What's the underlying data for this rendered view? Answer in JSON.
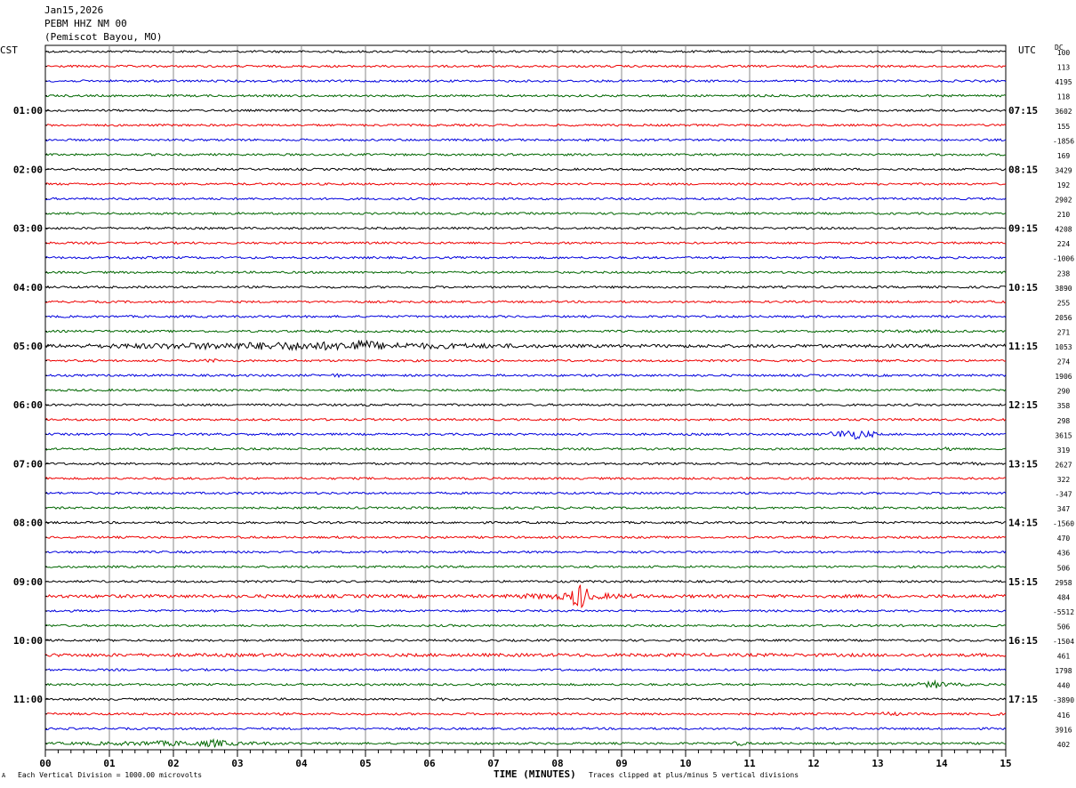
{
  "header": {
    "date": "Jan15,2026",
    "station": "PEBM HHZ NM 00",
    "location": "(Pemiscot Bayou, MO)"
  },
  "left_tz": "CST",
  "right_tz": "UTC",
  "dc_label": "DC",
  "footer": {
    "scale_note": "Each Vertical Division = 1000.00 microvolts",
    "clip_note": "Traces clipped at plus/minus 5 vertical divisions",
    "corner_mark": "A"
  },
  "colors": {
    "trace_cycle": [
      "#000000",
      "#ee0000",
      "#0000dd",
      "#006600"
    ],
    "grid": "#888888"
  },
  "chart_data": {
    "type": "line",
    "title": "",
    "xlabel": "TIME (MINUTES)",
    "ylabel": "",
    "xlim": [
      0,
      15
    ],
    "x_ticks": [
      "00",
      "01",
      "02",
      "03",
      "04",
      "05",
      "06",
      "07",
      "08",
      "09",
      "10",
      "11",
      "12",
      "13",
      "14",
      "15"
    ],
    "rows": 48,
    "minutes_per_row": 15,
    "left_hour_labels": [
      {
        "row": 4,
        "text": "01:00"
      },
      {
        "row": 8,
        "text": "02:00"
      },
      {
        "row": 12,
        "text": "03:00"
      },
      {
        "row": 16,
        "text": "04:00"
      },
      {
        "row": 20,
        "text": "05:00"
      },
      {
        "row": 24,
        "text": "06:00"
      },
      {
        "row": 28,
        "text": "07:00"
      },
      {
        "row": 32,
        "text": "08:00"
      },
      {
        "row": 36,
        "text": "09:00"
      },
      {
        "row": 40,
        "text": "10:00"
      },
      {
        "row": 44,
        "text": "11:00"
      }
    ],
    "right_hour_labels": [
      {
        "row": 4,
        "text": "07:15"
      },
      {
        "row": 8,
        "text": "08:15"
      },
      {
        "row": 12,
        "text": "09:15"
      },
      {
        "row": 16,
        "text": "10:15"
      },
      {
        "row": 20,
        "text": "11:15"
      },
      {
        "row": 24,
        "text": "12:15"
      },
      {
        "row": 28,
        "text": "13:15"
      },
      {
        "row": 32,
        "text": "14:15"
      },
      {
        "row": 36,
        "text": "15:15"
      },
      {
        "row": 40,
        "text": "16:15"
      },
      {
        "row": 44,
        "text": "17:15"
      }
    ],
    "dc_offsets": [
      "100",
      "113",
      "4195",
      "118",
      "3602",
      "155",
      "-1856",
      "169",
      "3429",
      "192",
      "2902",
      "210",
      "4208",
      "224",
      "-1006",
      "238",
      "3890",
      "255",
      "2056",
      "271",
      "1053",
      "274",
      "1906",
      "290",
      "358",
      "298",
      "3615",
      "319",
      "2627",
      "322",
      "-347",
      "347",
      "-1560",
      "470",
      "436",
      "506",
      "2958",
      "484",
      "-5512",
      "506",
      "-1504",
      "461",
      "1798",
      "440",
      "-3890",
      "416",
      "3916",
      "402"
    ],
    "base_amplitude": [
      2,
      2,
      2,
      2,
      2,
      2,
      2,
      2,
      2,
      2,
      2,
      2,
      2,
      2,
      2,
      2,
      2,
      2,
      2,
      2,
      3,
      2,
      2,
      2,
      2,
      2,
      2,
      2,
      2,
      2,
      2,
      2,
      2,
      2,
      2,
      2,
      2,
      3,
      2,
      2,
      2,
      3,
      2,
      2,
      2,
      2,
      2,
      2
    ],
    "events": [
      {
        "row": 14,
        "start": 0.4,
        "end": 2.2,
        "amp": 3
      },
      {
        "row": 19,
        "start": 12.2,
        "end": 15.0,
        "amp": 3
      },
      {
        "row": 20,
        "start": 0.2,
        "end": 7.8,
        "amp": 8
      },
      {
        "row": 20,
        "start": 4.4,
        "end": 5.4,
        "amp": 12
      },
      {
        "row": 21,
        "start": 2.4,
        "end": 2.8,
        "amp": 4
      },
      {
        "row": 22,
        "start": 4.4,
        "end": 4.7,
        "amp": 4
      },
      {
        "row": 23,
        "start": 8.2,
        "end": 8.5,
        "amp": 4
      },
      {
        "row": 24,
        "start": 4.9,
        "end": 5.2,
        "amp": 3
      },
      {
        "row": 24,
        "start": 10.7,
        "end": 10.95,
        "amp": 3
      },
      {
        "row": 26,
        "start": 12.2,
        "end": 13.0,
        "amp": 10
      },
      {
        "row": 27,
        "start": 14.0,
        "end": 14.3,
        "amp": 5
      },
      {
        "row": 28,
        "start": 14.0,
        "end": 15.0,
        "amp": 3
      },
      {
        "row": 30,
        "start": 2.9,
        "end": 3.2,
        "amp": 3
      },
      {
        "row": 31,
        "start": 8.0,
        "end": 8.3,
        "amp": 3
      },
      {
        "row": 37,
        "start": 7.0,
        "end": 9.5,
        "amp": 7
      },
      {
        "row": 37,
        "start": 8.2,
        "end": 8.5,
        "amp": 28
      },
      {
        "row": 41,
        "start": 7.8,
        "end": 9.0,
        "amp": 3
      },
      {
        "row": 43,
        "start": 12.8,
        "end": 14.8,
        "amp": 4
      },
      {
        "row": 43,
        "start": 13.7,
        "end": 14.1,
        "amp": 8
      },
      {
        "row": 44,
        "start": 5.9,
        "end": 6.6,
        "amp": 3
      },
      {
        "row": 45,
        "start": 13.0,
        "end": 13.4,
        "amp": 5
      },
      {
        "row": 45,
        "start": 14.6,
        "end": 15.0,
        "amp": 4
      },
      {
        "row": 47,
        "start": 0.0,
        "end": 4.0,
        "amp": 5
      },
      {
        "row": 47,
        "start": 2.3,
        "end": 3.0,
        "amp": 8
      },
      {
        "row": 47,
        "start": 10.7,
        "end": 11.0,
        "amp": 5
      }
    ]
  }
}
